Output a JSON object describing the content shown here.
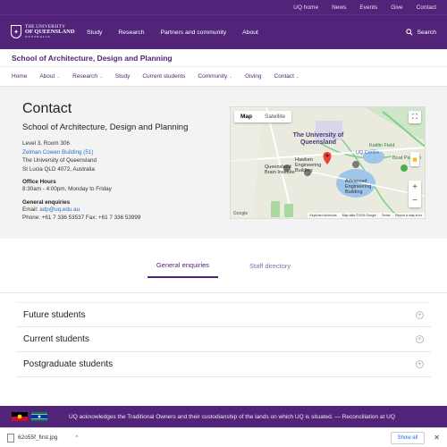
{
  "utility": [
    "UQ home",
    "News",
    "Events",
    "Give",
    "Contact"
  ],
  "logo": {
    "l1": "THE UNIVERSITY",
    "l2": "OF QUEENSLAND",
    "l3": "AUSTRALIA"
  },
  "nav": [
    "Study",
    "Research",
    "Partners and community",
    "About"
  ],
  "search_label": "Search",
  "school_title": "School of Architecture, Design and Planning",
  "subnav": [
    {
      "label": "Home",
      "dropdown": false
    },
    {
      "label": "About",
      "dropdown": true
    },
    {
      "label": "Research",
      "dropdown": true
    },
    {
      "label": "Study",
      "dropdown": false
    },
    {
      "label": "Current students",
      "dropdown": false
    },
    {
      "label": "Community",
      "dropdown": true
    },
    {
      "label": "Giving",
      "dropdown": false
    },
    {
      "label": "Contact",
      "dropdown": true
    }
  ],
  "contact": {
    "title": "Contact",
    "subtitle": "School of Architecture, Design and Planning",
    "address": [
      "Level 3, Room 306",
      "Zelman Cowen Building (51)",
      "The University of Queensland",
      "St Lucia QLD 4072, Australia"
    ],
    "hours_label": "Office Hours",
    "hours": "8:30am - 4:00pm, Monday to Friday",
    "enquiries_label": "General enquiries",
    "email_prefix": "Email: ",
    "email": "adp@uq.edu.au",
    "phone": "Phone: +61 7 336 53537  Fax: +61 7 336 53999"
  },
  "map": {
    "toggle": [
      "Map",
      "Satellite"
    ],
    "labels": [
      "The University of Queensland",
      "Hawken Engineering Building",
      "Queensland Brain Institute",
      "Advanced Engineering Building",
      "UQ Centre",
      "Kaitlin Field",
      "Boat Pavilion"
    ],
    "footer": [
      "Keyboard shortcuts",
      "Map data ©2024 Google",
      "Terms",
      "Report a map error"
    ],
    "brand": "Google"
  },
  "tabs": [
    "General enquiries",
    "Staff directory"
  ],
  "accordion": [
    "Future students",
    "Current students",
    "Postgraduate students"
  ],
  "acknowledgement": "UQ acknowledges the Traditional Owners and their custodianship of the lands on which UQ is situated. — Reconciliation at UQ",
  "download": {
    "file": "62o55f_first.jpg",
    "show_all": "Show all"
  }
}
